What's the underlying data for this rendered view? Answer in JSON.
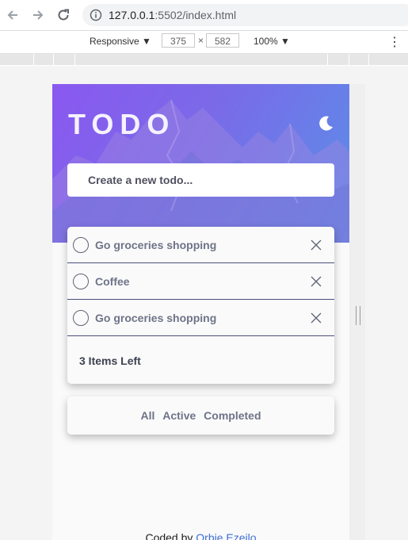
{
  "browser": {
    "url_host": "127.0.0.1",
    "url_rest": ":5502/index.html"
  },
  "devtools": {
    "device": "Responsive",
    "width": "375",
    "times": "×",
    "height": "582",
    "zoom": "100%",
    "more": "⋮"
  },
  "app": {
    "title": "TODO",
    "input_placeholder": "Create a new todo...",
    "todos": [
      {
        "text": "Go groceries shopping"
      },
      {
        "text": "Coffee"
      },
      {
        "text": "Go groceries shopping"
      }
    ],
    "items_left": "3 Items Left",
    "filters": {
      "all": "All",
      "active": "Active",
      "completed": "Completed"
    },
    "credit_prefix": "Coded by",
    "credit_author": "Orbie Ezeilo"
  },
  "colors": {
    "accent_purple": "#8a58f0",
    "accent_blue": "#5a8fe8",
    "divider": "#4b4e7a",
    "link": "#3d6fd6"
  }
}
